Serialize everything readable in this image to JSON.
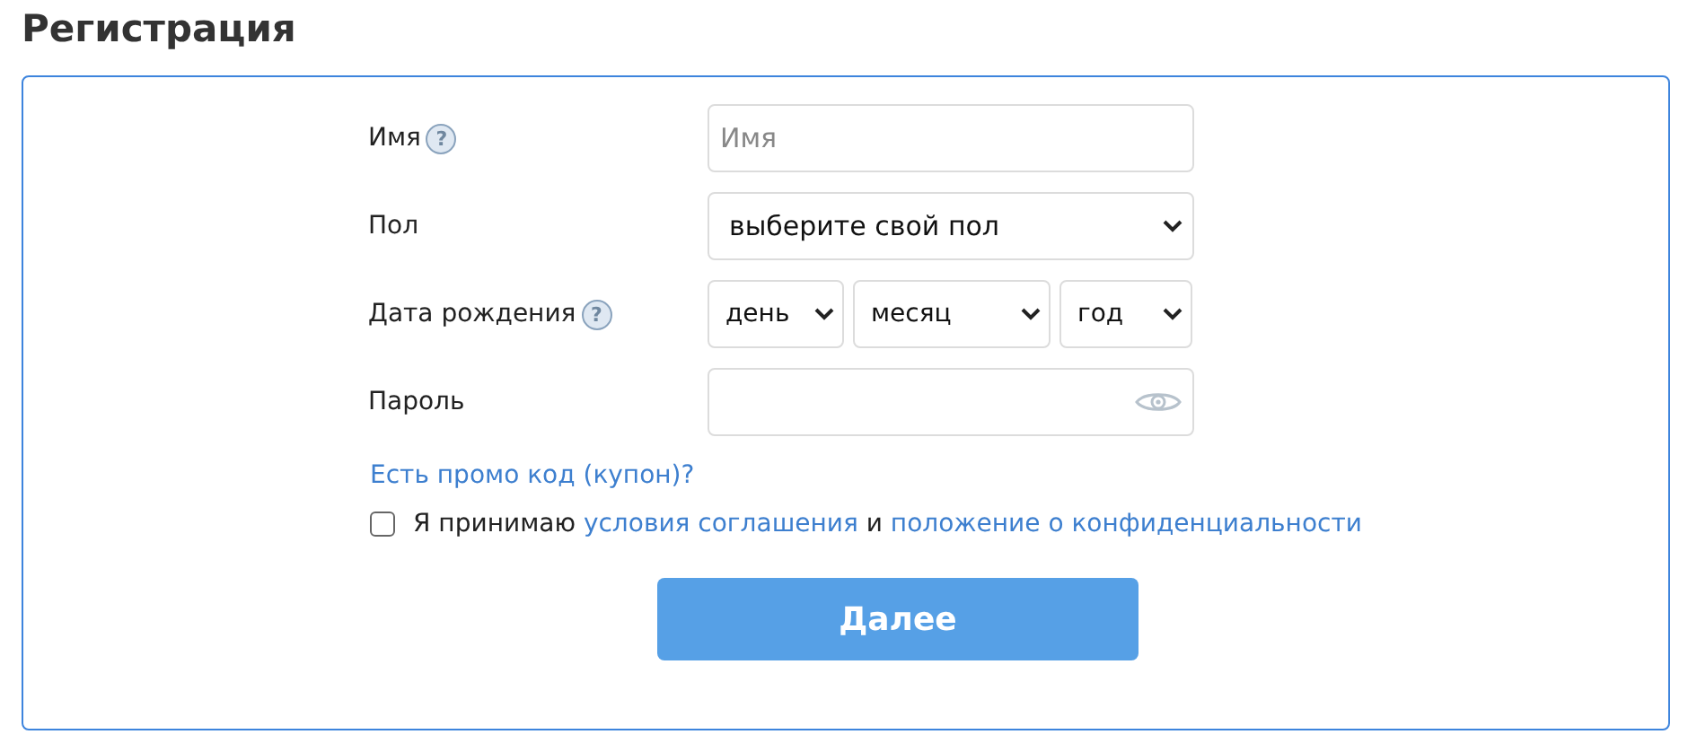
{
  "title": "Регистрация",
  "fields": [
    {
      "kind": "text",
      "label": "Имя",
      "help": "?",
      "placeholder": "Имя"
    },
    {
      "kind": "select",
      "label": "Пол",
      "selects": [
        {
          "value": "выберите свой пол"
        }
      ]
    },
    {
      "kind": "selects",
      "label": "Дата рождения",
      "help": "?",
      "selects": [
        {
          "value": "день"
        },
        {
          "value": "месяц"
        },
        {
          "value": "год"
        }
      ]
    },
    {
      "kind": "password",
      "label": "Пароль"
    }
  ],
  "promo_link": "Есть промо код (купон)?",
  "agreement": {
    "checked": false,
    "text": "Я принимаю",
    "terms_link": "условия соглашения",
    "joiner": "и",
    "privacy_link": "положение о конфиденциальности"
  },
  "submit_button": "Далее"
}
